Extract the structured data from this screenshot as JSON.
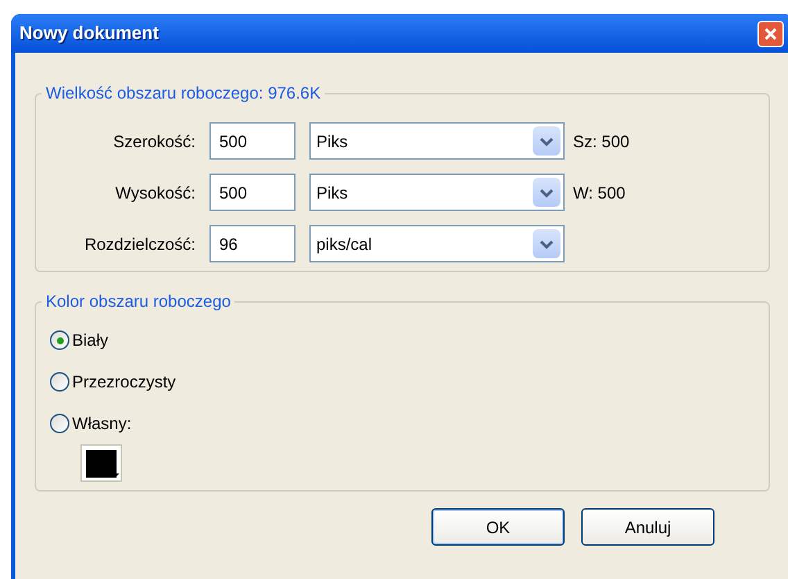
{
  "window": {
    "title": "Nowy dokument"
  },
  "size_group": {
    "legend": "Wielkość obszaru roboczego: 976.6K",
    "rows": [
      {
        "label": "Szerokość:",
        "value": "500",
        "unit": "Piks",
        "reading": "Sz: 500"
      },
      {
        "label": "Wysokość:",
        "value": "500",
        "unit": "Piks",
        "reading": "W: 500"
      },
      {
        "label": "Rozdzielczość:",
        "value": "96",
        "unit": "piks/cal"
      }
    ]
  },
  "color_group": {
    "legend": "Kolor obszaru roboczego",
    "options": [
      {
        "label": "Biały",
        "selected": true
      },
      {
        "label": "Przezroczysty",
        "selected": false
      },
      {
        "label": "Własny:",
        "selected": false
      }
    ],
    "custom_color": {
      "color": "#000000"
    }
  },
  "buttons": [
    {
      "label": "OK",
      "default": true
    },
    {
      "label": "Anuluj",
      "default": false
    }
  ]
}
